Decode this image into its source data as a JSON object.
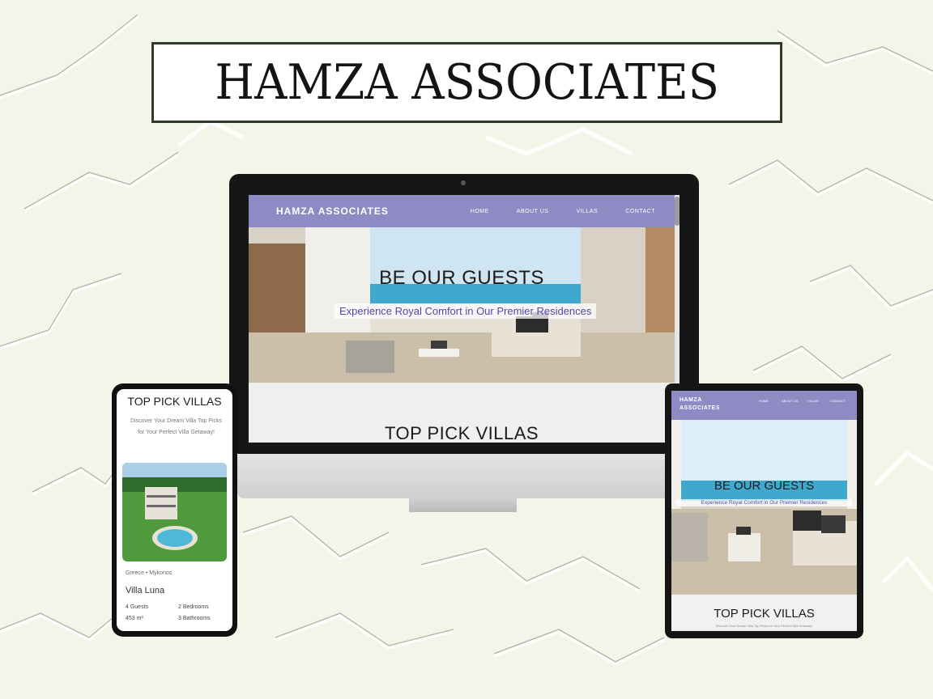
{
  "banner": {
    "title": "HAMZA ASSOCIATES"
  },
  "desktop": {
    "nav": {
      "logo": "HAMZA ASSOCIATES",
      "links": [
        "HOME",
        "ABOUT US",
        "VILLAS",
        "CONTACT"
      ]
    },
    "hero": {
      "title": "BE OUR GUESTS",
      "subtitle": "Experience Royal Comfort in Our Premier Residences"
    },
    "section_title": "TOP PICK VILLAS"
  },
  "phone": {
    "title": "TOP PICK VILLAS",
    "description": "Discover Your Dream Villa Top Picks for Your Perfect Villa Getaway!",
    "card": {
      "location": "Greece • Mykonos",
      "name": "Villa Luna",
      "specs": [
        "4 Guests",
        "2 Bedrooms",
        "453 m²",
        "3 Bathrooms"
      ]
    }
  },
  "tablet": {
    "nav": {
      "logo_line1": "HAMZA",
      "logo_line2": "ASSOCIATES",
      "links": [
        "HOME",
        "ABOUT US",
        "VILLAS",
        "CONTACT"
      ]
    },
    "hero": {
      "title": "BE OUR GUESTS",
      "subtitle": "Experience Royal Comfort in Our Premier Residences"
    },
    "section_title": "TOP PICK VILLAS",
    "section_desc": "Discover Your Dream Villa Top Picks for Your Perfect Villa Getaway!"
  },
  "colors": {
    "nav_purple": "#8d8ac4",
    "subtitle_blue": "#4b4aa8",
    "banner_border": "#2f3a26",
    "background": "#f3f5e9"
  }
}
